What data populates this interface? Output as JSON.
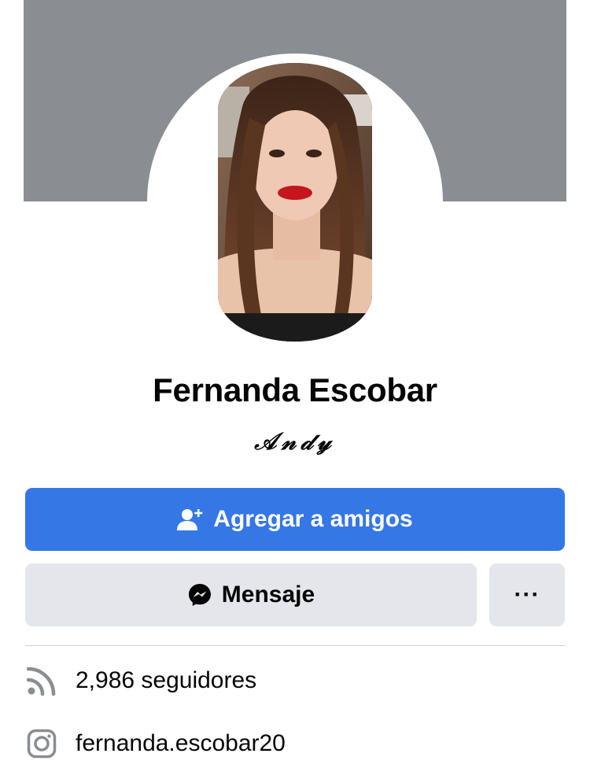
{
  "profile": {
    "name": "Fernanda Escobar",
    "nickname": "𝒜𝓃𝒹𝓎"
  },
  "actions": {
    "add_friend_label": "Agregar a amigos",
    "message_label": "Mensaje",
    "more_label": "···"
  },
  "info": {
    "followers_text": "2,986 seguidores",
    "instagram_text": "fernanda.escobar20"
  },
  "icons": {
    "add_friend": "add-friend-icon",
    "messenger": "messenger-icon",
    "followers": "rss-followers-icon",
    "instagram": "instagram-icon"
  },
  "colors": {
    "primary": "#3577e5",
    "secondary_bg": "#e4e6eb",
    "cover": "#8a8d91",
    "icon_gray": "#65676b"
  }
}
